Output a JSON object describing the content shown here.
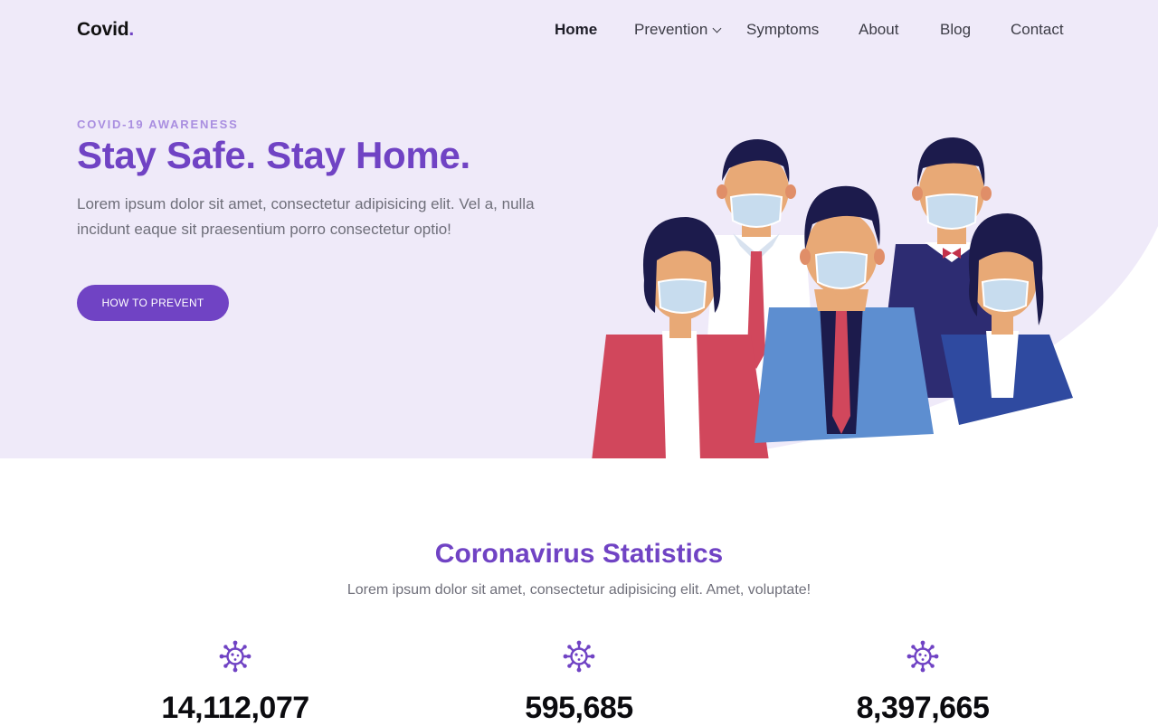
{
  "brand": {
    "name": "Covid",
    "dot": "."
  },
  "nav": {
    "items": [
      {
        "label": "Home",
        "active": true
      },
      {
        "label": "Prevention",
        "dropdown": true
      },
      {
        "label": "Symptoms"
      },
      {
        "label": "About"
      },
      {
        "label": "Blog"
      },
      {
        "label": "Contact"
      }
    ],
    "dropdown_icon": "chevron-down-icon"
  },
  "hero": {
    "eyebrow": "COVID-19 AWARENESS",
    "title": "Stay Safe. Stay Home.",
    "lead": "Lorem ipsum dolor sit amet, consectetur adipisicing elit. Vel a, nulla incidunt eaque sit praesentium porro consectetur optio!",
    "cta": "HOW TO PREVENT",
    "illustration": "people-wearing-masks-illustration"
  },
  "stats": {
    "title": "Coronavirus Statistics",
    "subtitle": "Lorem ipsum dolor sit amet, consectetur adipisicing elit. Amet, voluptate!",
    "items": [
      {
        "icon": "virus-icon",
        "value": "14,112,077"
      },
      {
        "icon": "virus-icon",
        "value": "595,685"
      },
      {
        "icon": "virus-icon",
        "value": "8,397,665"
      }
    ]
  },
  "colors": {
    "accent": "#7043c4",
    "accent_light": "#a98ee0",
    "hero_bg": "#efeaf9",
    "text_muted": "#6f6f7a"
  }
}
